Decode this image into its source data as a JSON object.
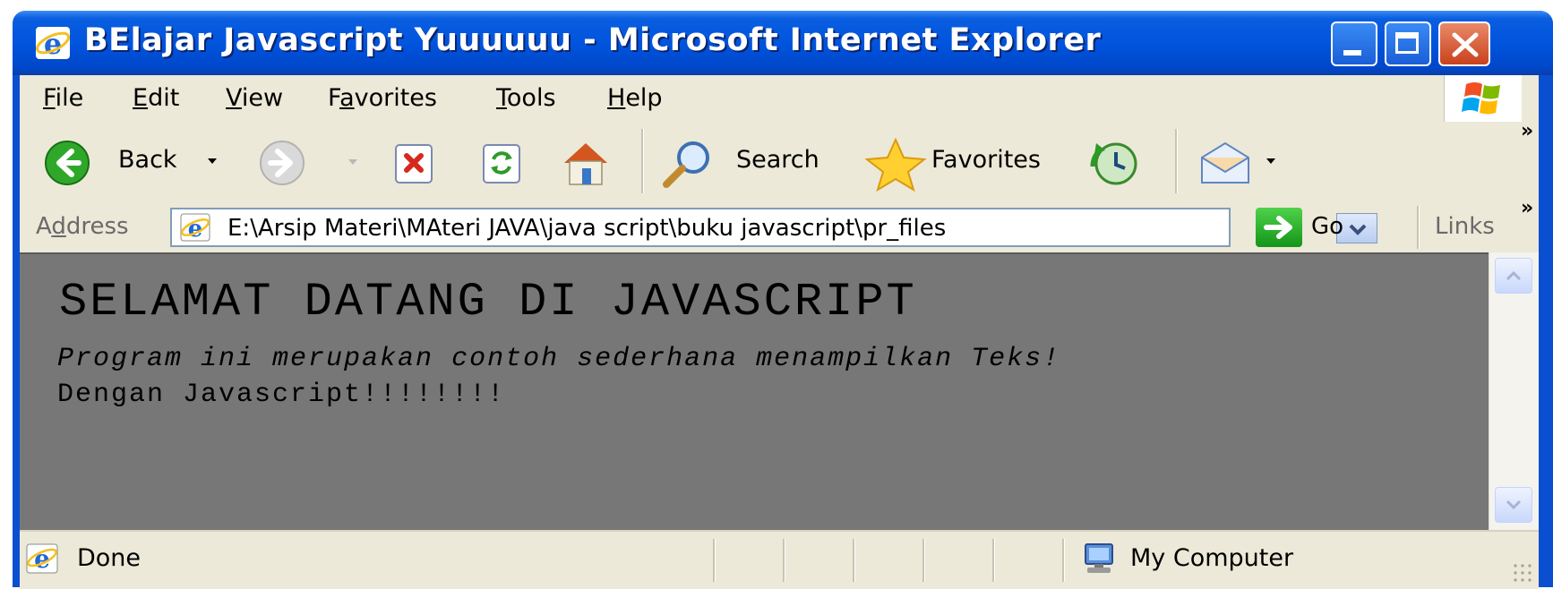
{
  "window": {
    "title": "BElajar Javascript Yuuuuuu - Microsoft Internet Explorer"
  },
  "menu": {
    "items": [
      {
        "label_underlined": "F",
        "label_rest": "ile"
      },
      {
        "label_underlined": "E",
        "label_rest": "dit"
      },
      {
        "label_underlined": "V",
        "label_rest": "iew"
      },
      {
        "label_pre": "F",
        "label_underlined": "a",
        "label_rest": "vorites"
      },
      {
        "label_underlined": "T",
        "label_rest": "ools"
      },
      {
        "label_underlined": "H",
        "label_rest": "elp"
      }
    ]
  },
  "toolbar": {
    "back_label": "Back",
    "search_label": "Search",
    "favorites_label": "Favorites",
    "overflow": "»"
  },
  "address": {
    "label_pre": "A",
    "label_underlined": "d",
    "label_rest": "dress",
    "value": "E:\\Arsip Materi\\MAteri JAVA\\java script\\buku javascript\\pr_files",
    "go_label": "Go",
    "links_label": "Links",
    "overflow": "»"
  },
  "page": {
    "heading": "SELAMAT DATANG DI JAVASCRIPT",
    "line1": "Program ini merupakan contoh sederhana menampilkan Teks!",
    "line2": "Dengan Javascript!!!!!!!!",
    "background": "#777777"
  },
  "status": {
    "text": "Done",
    "zone": "My Computer"
  },
  "colors": {
    "titlebar": "#0053dc",
    "chrome": "#ece9d8"
  }
}
